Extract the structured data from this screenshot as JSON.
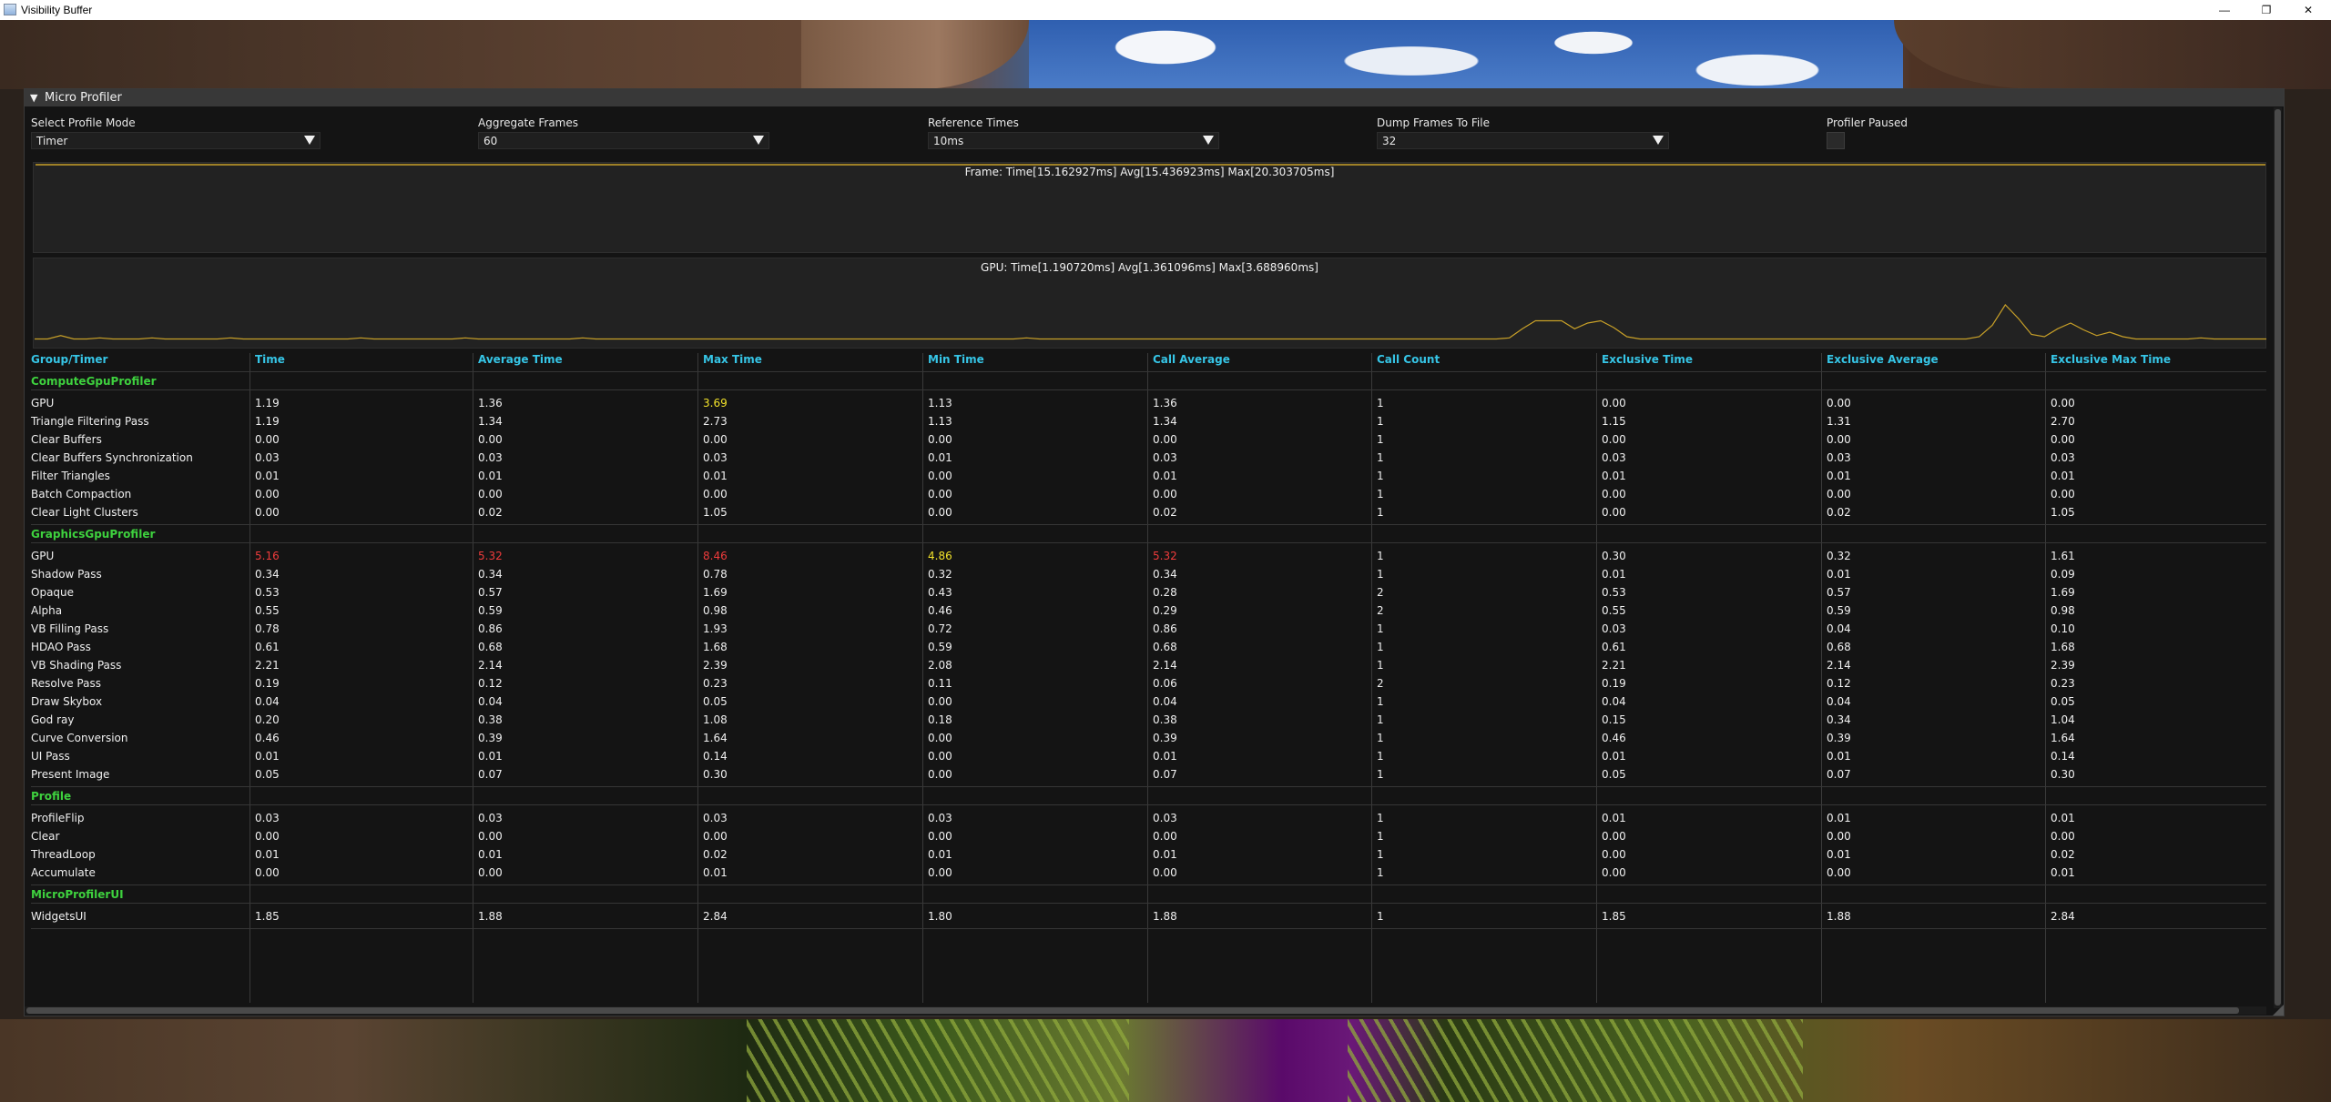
{
  "window": {
    "title": "Visibility Buffer",
    "minimize_glyph": "—",
    "maximize_glyph": "❐",
    "close_glyph": "✕"
  },
  "profiler": {
    "title": "Micro Profiler",
    "collapse_glyph": "▼",
    "controls": {
      "profile_mode": {
        "label": "Select Profile Mode",
        "value": "Timer"
      },
      "aggregate_frames": {
        "label": "Aggregate Frames",
        "value": "60"
      },
      "reference_times": {
        "label": "Reference Times",
        "value": "10ms"
      },
      "dump_frames": {
        "label": "Dump Frames To File",
        "value": "32"
      },
      "paused": {
        "label": "Profiler Paused",
        "checked": false
      }
    },
    "frame_graph": {
      "label": "Frame: Time[15.162927ms] Avg[15.436923ms] Max[20.303705ms]",
      "line_color": "#c8a028",
      "level": 0.5
    },
    "gpu_graph": {
      "label": "GPU: Time[1.190720ms] Avg[1.361096ms] Max[3.688960ms]",
      "line_color": "#c8a028",
      "samples": [
        0.6,
        0.6,
        0.9,
        0.6,
        0.6,
        0.7,
        0.6,
        0.6,
        0.6,
        0.7,
        0.6,
        0.6,
        0.6,
        0.6,
        0.6,
        0.7,
        0.6,
        0.6,
        0.6,
        0.6,
        0.6,
        0.6,
        0.6,
        0.6,
        0.6,
        0.7,
        0.6,
        0.6,
        0.6,
        0.6,
        0.6,
        0.6,
        0.6,
        0.7,
        0.6,
        0.6,
        0.6,
        0.6,
        0.6,
        0.6,
        0.6,
        0.6,
        0.7,
        0.6,
        0.6,
        0.6,
        0.6,
        0.6,
        0.6,
        0.6,
        0.6,
        0.6,
        0.6,
        0.6,
        0.6,
        0.6,
        0.6,
        0.6,
        0.6,
        0.6,
        0.6,
        0.6,
        0.6,
        0.6,
        0.6,
        0.6,
        0.6,
        0.6,
        0.6,
        0.6,
        0.6,
        0.6,
        0.6,
        0.6,
        0.6,
        0.6,
        0.7,
        0.6,
        0.6,
        0.6,
        0.6,
        0.6,
        0.6,
        0.6,
        0.6,
        0.6,
        0.6,
        0.6,
        0.6,
        0.6,
        0.6,
        0.6,
        0.6,
        0.6,
        0.6,
        0.6,
        0.6,
        0.6,
        0.6,
        0.6,
        0.6,
        0.6,
        0.6,
        0.6,
        0.6,
        0.6,
        0.6,
        0.6,
        0.6,
        0.6,
        0.6,
        0.6,
        0.6,
        0.7,
        1.5,
        2.2,
        2.2,
        2.2,
        1.5,
        2.0,
        2.2,
        1.6,
        0.8,
        0.6,
        0.6,
        0.6,
        0.6,
        0.6,
        0.6,
        0.6,
        0.6,
        0.6,
        0.6,
        0.6,
        0.6,
        0.6,
        0.6,
        0.6,
        0.6,
        0.6,
        0.6,
        0.6,
        0.6,
        0.6,
        0.6,
        0.6,
        0.6,
        0.6,
        0.6,
        0.8,
        1.8,
        3.6,
        2.4,
        1.0,
        0.8,
        1.5,
        2.0,
        1.4,
        0.9,
        1.2,
        0.8,
        0.6,
        0.6,
        0.6,
        0.6,
        0.6,
        0.7,
        0.6,
        0.6,
        0.6,
        0.6,
        0.6
      ]
    }
  },
  "table": {
    "headers": [
      "Group/Timer",
      "Time",
      "Average Time",
      "Max Time",
      "Min Time",
      "Call Average",
      "Call Count",
      "Exclusive Time",
      "Exclusive Average",
      "Exclusive Max Time"
    ],
    "groups": [
      {
        "name": "ComputeGpuProfiler",
        "rows": [
          {
            "name": "GPU",
            "values": [
              "1.19",
              "1.36",
              "3.69",
              "1.13",
              "1.36",
              "1",
              "0.00",
              "0.00",
              "0.00"
            ],
            "colors": {
              "2": "yellow"
            }
          },
          {
            "name": "Triangle Filtering Pass",
            "values": [
              "1.19",
              "1.34",
              "2.73",
              "1.13",
              "1.34",
              "1",
              "1.15",
              "1.31",
              "2.70"
            ]
          },
          {
            "name": "Clear Buffers",
            "values": [
              "0.00",
              "0.00",
              "0.00",
              "0.00",
              "0.00",
              "1",
              "0.00",
              "0.00",
              "0.00"
            ]
          },
          {
            "name": "Clear Buffers Synchronization",
            "values": [
              "0.03",
              "0.03",
              "0.03",
              "0.01",
              "0.03",
              "1",
              "0.03",
              "0.03",
              "0.03"
            ]
          },
          {
            "name": "Filter Triangles",
            "values": [
              "0.01",
              "0.01",
              "0.01",
              "0.00",
              "0.01",
              "1",
              "0.01",
              "0.01",
              "0.01"
            ]
          },
          {
            "name": "Batch Compaction",
            "values": [
              "0.00",
              "0.00",
              "0.00",
              "0.00",
              "0.00",
              "1",
              "0.00",
              "0.00",
              "0.00"
            ]
          },
          {
            "name": "Clear Light Clusters",
            "values": [
              "0.00",
              "0.02",
              "1.05",
              "0.00",
              "0.02",
              "1",
              "0.00",
              "0.02",
              "1.05"
            ]
          }
        ]
      },
      {
        "name": "GraphicsGpuProfiler",
        "rows": [
          {
            "name": "GPU",
            "values": [
              "5.16",
              "5.32",
              "8.46",
              "4.86",
              "5.32",
              "1",
              "0.30",
              "0.32",
              "1.61"
            ],
            "colors": {
              "0": "red",
              "1": "red",
              "2": "red",
              "3": "yellow",
              "4": "red"
            }
          },
          {
            "name": "Shadow Pass",
            "values": [
              "0.34",
              "0.34",
              "0.78",
              "0.32",
              "0.34",
              "1",
              "0.01",
              "0.01",
              "0.09"
            ]
          },
          {
            "name": "Opaque",
            "values": [
              "0.53",
              "0.57",
              "1.69",
              "0.43",
              "0.28",
              "2",
              "0.53",
              "0.57",
              "1.69"
            ]
          },
          {
            "name": "Alpha",
            "values": [
              "0.55",
              "0.59",
              "0.98",
              "0.46",
              "0.29",
              "2",
              "0.55",
              "0.59",
              "0.98"
            ]
          },
          {
            "name": "VB Filling Pass",
            "values": [
              "0.78",
              "0.86",
              "1.93",
              "0.72",
              "0.86",
              "1",
              "0.03",
              "0.04",
              "0.10"
            ]
          },
          {
            "name": "HDAO Pass",
            "values": [
              "0.61",
              "0.68",
              "1.68",
              "0.59",
              "0.68",
              "1",
              "0.61",
              "0.68",
              "1.68"
            ]
          },
          {
            "name": "VB Shading Pass",
            "values": [
              "2.21",
              "2.14",
              "2.39",
              "2.08",
              "2.14",
              "1",
              "2.21",
              "2.14",
              "2.39"
            ]
          },
          {
            "name": "Resolve Pass",
            "values": [
              "0.19",
              "0.12",
              "0.23",
              "0.11",
              "0.06",
              "2",
              "0.19",
              "0.12",
              "0.23"
            ]
          },
          {
            "name": "Draw Skybox",
            "values": [
              "0.04",
              "0.04",
              "0.05",
              "0.00",
              "0.04",
              "1",
              "0.04",
              "0.04",
              "0.05"
            ]
          },
          {
            "name": "God ray",
            "values": [
              "0.20",
              "0.38",
              "1.08",
              "0.18",
              "0.38",
              "1",
              "0.15",
              "0.34",
              "1.04"
            ]
          },
          {
            "name": "Curve Conversion",
            "values": [
              "0.46",
              "0.39",
              "1.64",
              "0.00",
              "0.39",
              "1",
              "0.46",
              "0.39",
              "1.64"
            ]
          },
          {
            "name": "UI Pass",
            "values": [
              "0.01",
              "0.01",
              "0.14",
              "0.00",
              "0.01",
              "1",
              "0.01",
              "0.01",
              "0.14"
            ]
          },
          {
            "name": "Present Image",
            "values": [
              "0.05",
              "0.07",
              "0.30",
              "0.00",
              "0.07",
              "1",
              "0.05",
              "0.07",
              "0.30"
            ]
          }
        ]
      },
      {
        "name": "Profile",
        "rows": [
          {
            "name": "ProfileFlip",
            "values": [
              "0.03",
              "0.03",
              "0.03",
              "0.03",
              "0.03",
              "1",
              "0.01",
              "0.01",
              "0.01"
            ]
          },
          {
            "name": "Clear",
            "values": [
              "0.00",
              "0.00",
              "0.00",
              "0.00",
              "0.00",
              "1",
              "0.00",
              "0.00",
              "0.00"
            ]
          },
          {
            "name": "ThreadLoop",
            "values": [
              "0.01",
              "0.01",
              "0.02",
              "0.01",
              "0.01",
              "1",
              "0.00",
              "0.01",
              "0.02"
            ]
          },
          {
            "name": "Accumulate",
            "values": [
              "0.00",
              "0.00",
              "0.01",
              "0.00",
              "0.00",
              "1",
              "0.00",
              "0.00",
              "0.01"
            ]
          }
        ]
      },
      {
        "name": "MicroProfilerUI",
        "rows": [
          {
            "name": "WidgetsUI",
            "values": [
              "1.85",
              "1.88",
              "2.84",
              "1.80",
              "1.88",
              "1",
              "1.85",
              "1.88",
              "2.84"
            ]
          }
        ]
      }
    ]
  }
}
